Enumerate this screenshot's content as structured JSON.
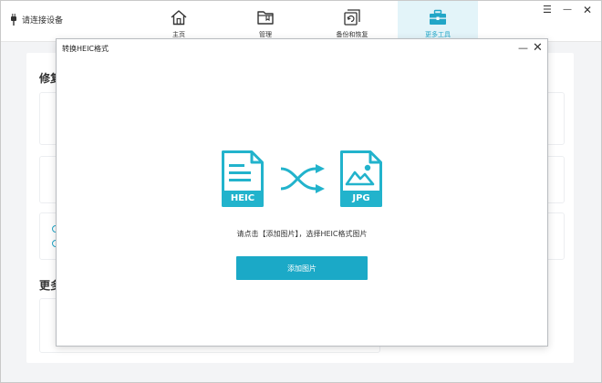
{
  "app": {
    "device_status": "请连接设备",
    "window_controls": {
      "menu": "☰",
      "minimize": "—",
      "close": "✕"
    }
  },
  "nav": {
    "tabs": [
      {
        "label": "主页",
        "icon": "home-icon",
        "active": false
      },
      {
        "label": "管理",
        "icon": "folder-icon",
        "active": false
      },
      {
        "label": "备份和恢复",
        "icon": "backup-restore-icon",
        "active": false
      },
      {
        "label": "更多工具",
        "icon": "toolbox-icon",
        "active": true
      }
    ]
  },
  "background": {
    "heading_1": "修复",
    "heading_2": "更多"
  },
  "modal": {
    "title": "转换HEIC格式",
    "minimize": "—",
    "close": "✕",
    "source_format": "HEIC",
    "target_format": "JPG",
    "instruction": "请点击【添加图片】，选择HEIC格式图片",
    "add_button": "添加图片"
  },
  "colors": {
    "accent": "#1ba9c7",
    "icon_teal": "#22b3cc",
    "active_tab_bg": "#e3f4f9"
  }
}
